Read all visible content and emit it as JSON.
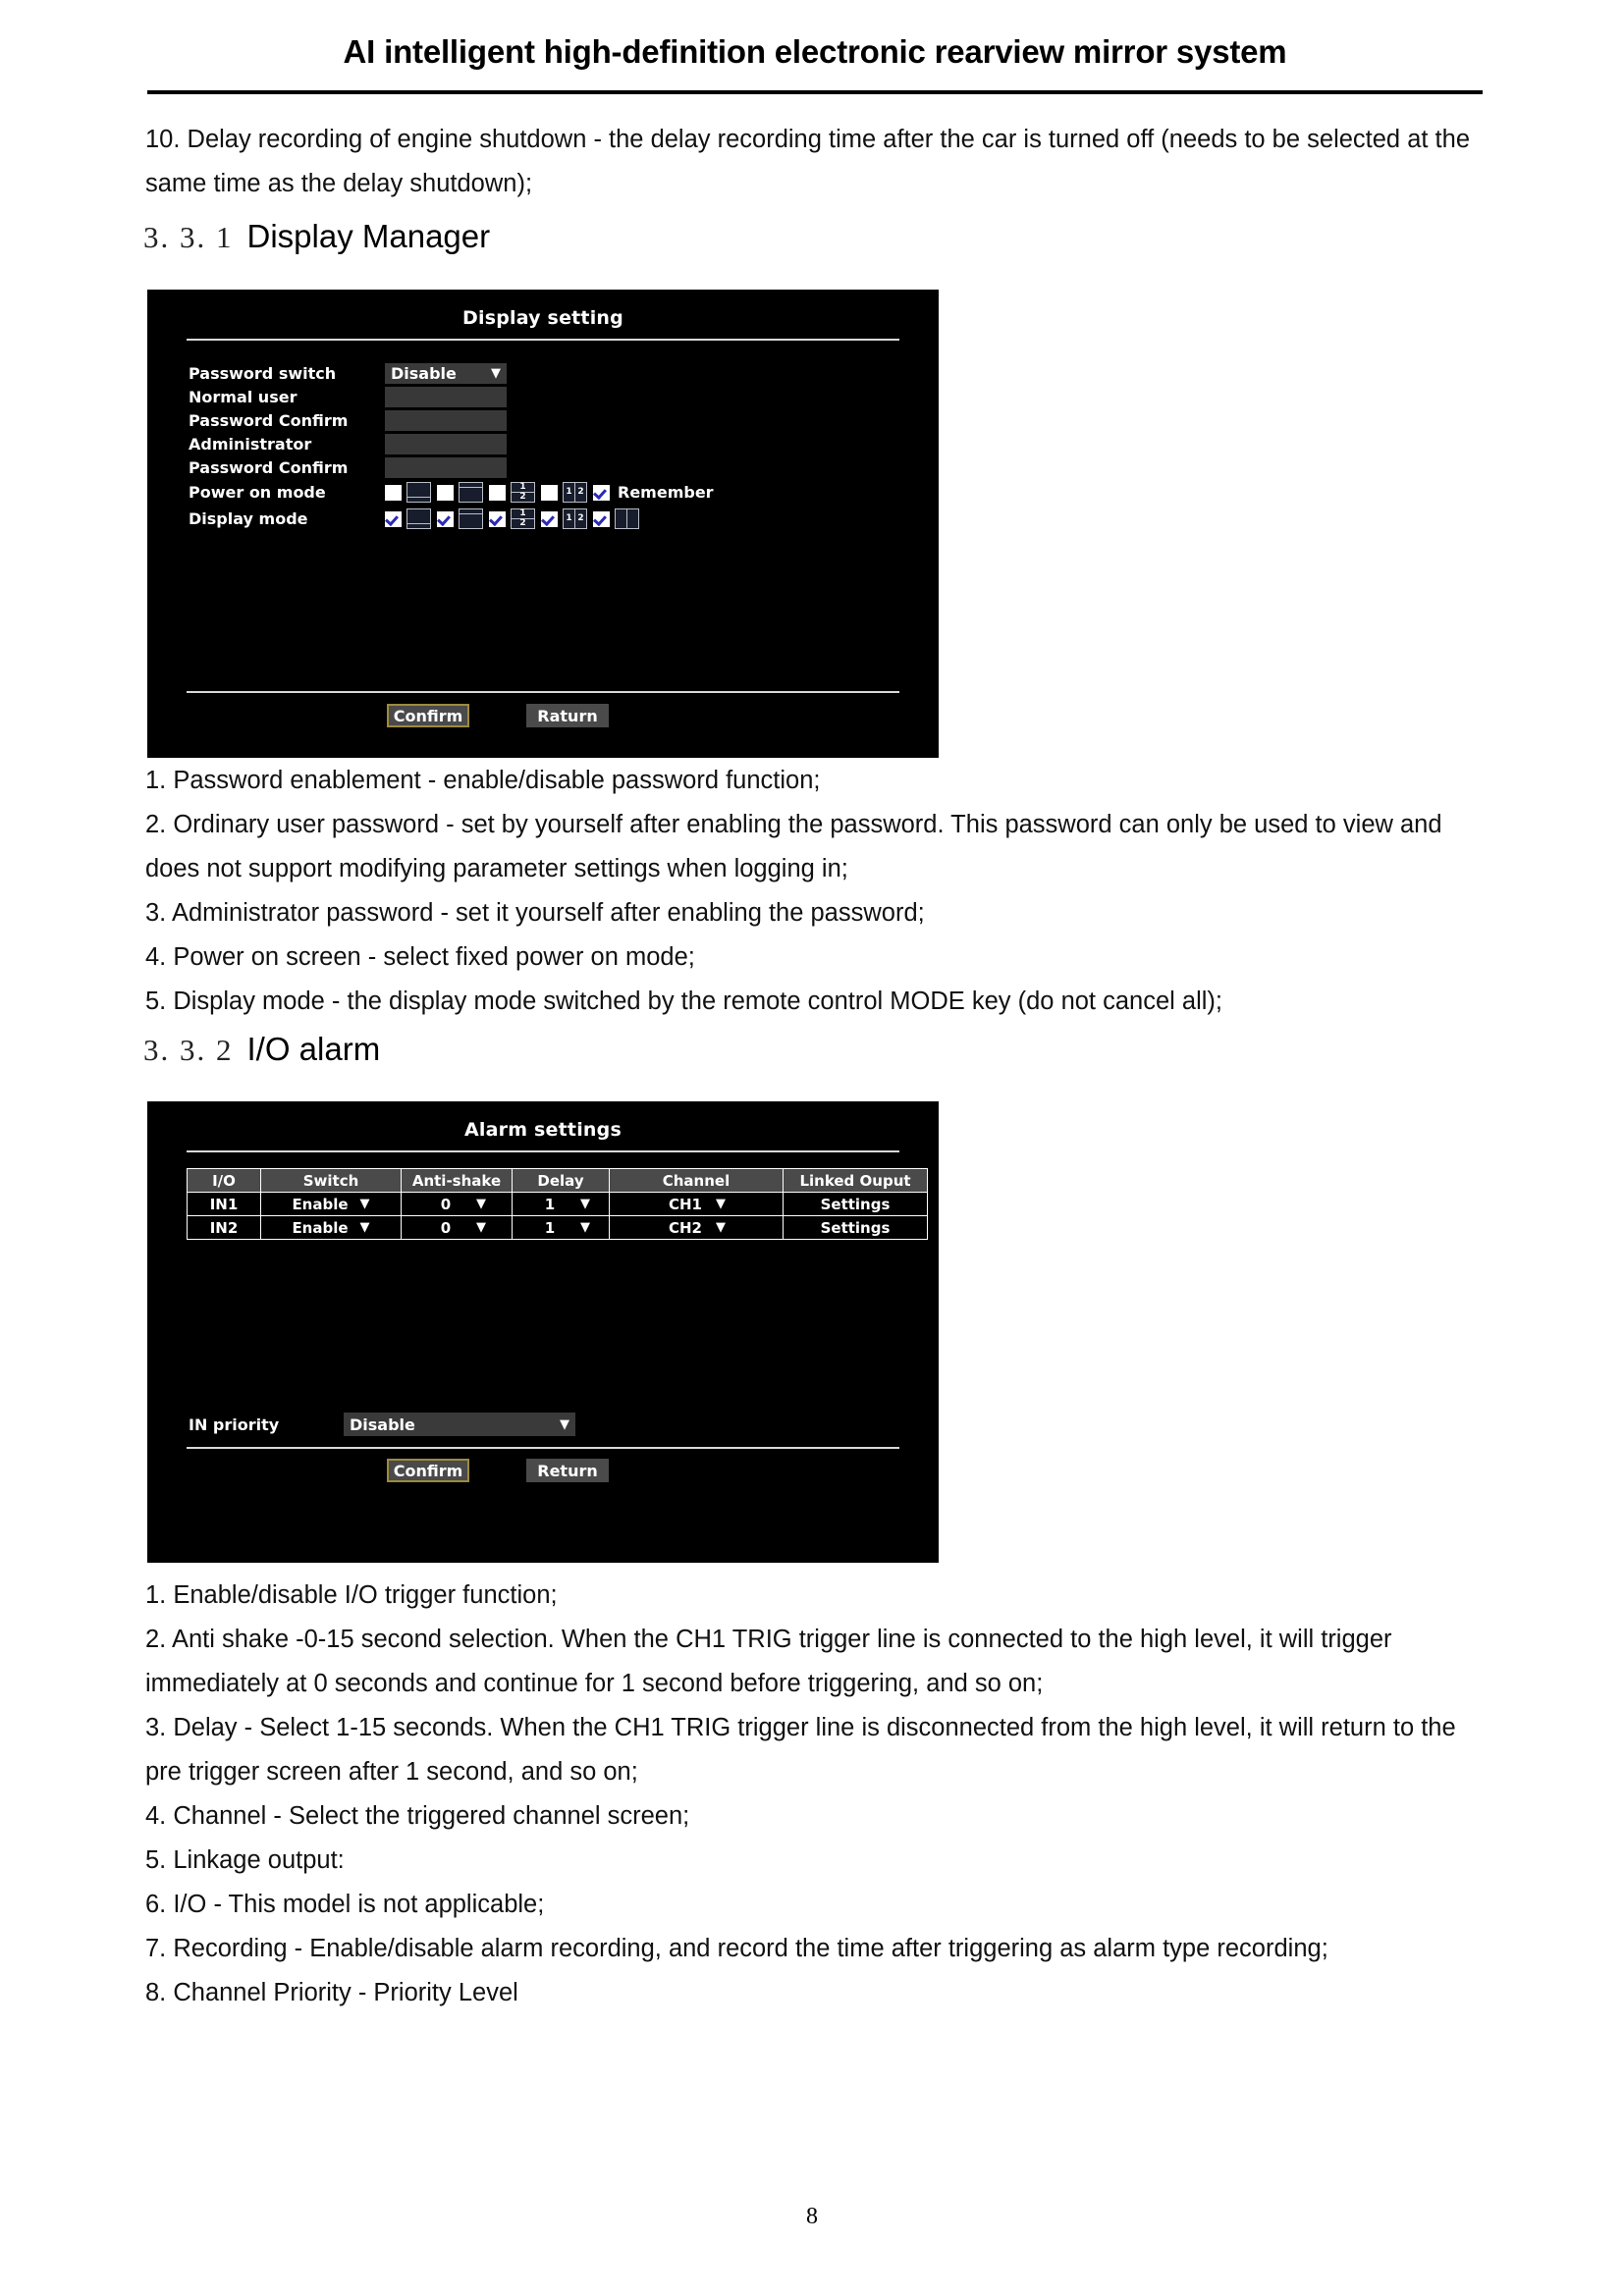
{
  "header": {
    "title": "AI intelligent high-definition electronic rearview mirror system"
  },
  "intro_paragraph": "10. Delay recording of engine shutdown - the delay recording time after the car is turned off (needs to be selected at the same time as the delay shutdown);",
  "section_display": {
    "number": "3. 3. 1",
    "title": "Display Manager"
  },
  "display_setting_panel": {
    "title": "Display setting",
    "rows": [
      {
        "label": "Password switch",
        "value": "Disable",
        "type": "dropdown"
      },
      {
        "label": "Normal user",
        "value": "",
        "type": "input"
      },
      {
        "label": "Password Confirm",
        "value": "",
        "type": "input"
      },
      {
        "label": "Administrator",
        "value": "",
        "type": "input"
      },
      {
        "label": "Password Confirm",
        "value": "",
        "type": "input"
      }
    ],
    "power_on_mode": {
      "label": "Power on mode",
      "options": [
        {
          "icon": "layout-big-top-thin-bottom",
          "checked": false
        },
        {
          "icon": "layout-thin-top-big-bottom",
          "checked": false
        },
        {
          "icon": "layout-split-horizontal-1-2",
          "checked": false
        },
        {
          "icon": "layout-split-vertical-1-2",
          "checked": false
        }
      ],
      "remember_label": "Remember",
      "remember_checked": true
    },
    "display_mode": {
      "label": "Display mode",
      "options": [
        {
          "icon": "layout-big-top-thin-bottom",
          "checked": true
        },
        {
          "icon": "layout-thin-top-big-bottom",
          "checked": true
        },
        {
          "icon": "layout-split-horizontal-1-2",
          "checked": true
        },
        {
          "icon": "layout-split-vertical-1-2",
          "checked": true
        },
        {
          "icon": "layout-split-vertical-plain",
          "checked": true
        }
      ]
    },
    "buttons": {
      "confirm": "Confirm",
      "return": "Raturn"
    }
  },
  "display_notes": [
    "1. Password enablement - enable/disable password function;",
    "2. Ordinary user password - set by yourself after enabling the password. This password can only be used to view and does not support modifying parameter settings when logging in;",
    "3. Administrator password - set it yourself after enabling the password;",
    "4. Power on screen - select fixed power on mode;",
    "5. Display mode - the display mode switched by the remote control MODE key (do not cancel all);"
  ],
  "section_alarm": {
    "number": "3. 3. 2",
    "title": "I/O alarm"
  },
  "alarm_panel": {
    "title": "Alarm settings",
    "columns": [
      "I/O",
      "Switch",
      "Anti-shake",
      "Delay",
      "Channel",
      "Linked Ouput"
    ],
    "rows": [
      {
        "io": "IN1",
        "switch": "Enable",
        "anti_shake": "0",
        "delay": "1",
        "channel": "CH1",
        "linked_output": "Settings"
      },
      {
        "io": "IN2",
        "switch": "Enable",
        "anti_shake": "0",
        "delay": "1",
        "channel": "CH2",
        "linked_output": "Settings"
      }
    ],
    "in_priority": {
      "label": "IN priority",
      "value": "Disable"
    },
    "buttons": {
      "confirm": "Confirm",
      "return": "Return"
    }
  },
  "alarm_notes": [
    "1. Enable/disable I/O trigger function;",
    "2. Anti shake -0-15 second selection. When the CH1 TRIG trigger line is connected to the high level, it will trigger immediately at 0 seconds and continue for 1 second before triggering, and so on;",
    "3. Delay - Select 1-15 seconds. When the CH1 TRIG trigger line is disconnected from the high level, it will return to the pre trigger screen after 1 second, and so on;",
    "4. Channel - Select the triggered channel screen;",
    "5. Linkage output:",
    "6. I/O - This model is not applicable;",
    "7. Recording - Enable/disable alarm recording, and record the time after triggering as alarm type recording;",
    "8. Channel Priority - Priority Level"
  ],
  "page_number": "8"
}
